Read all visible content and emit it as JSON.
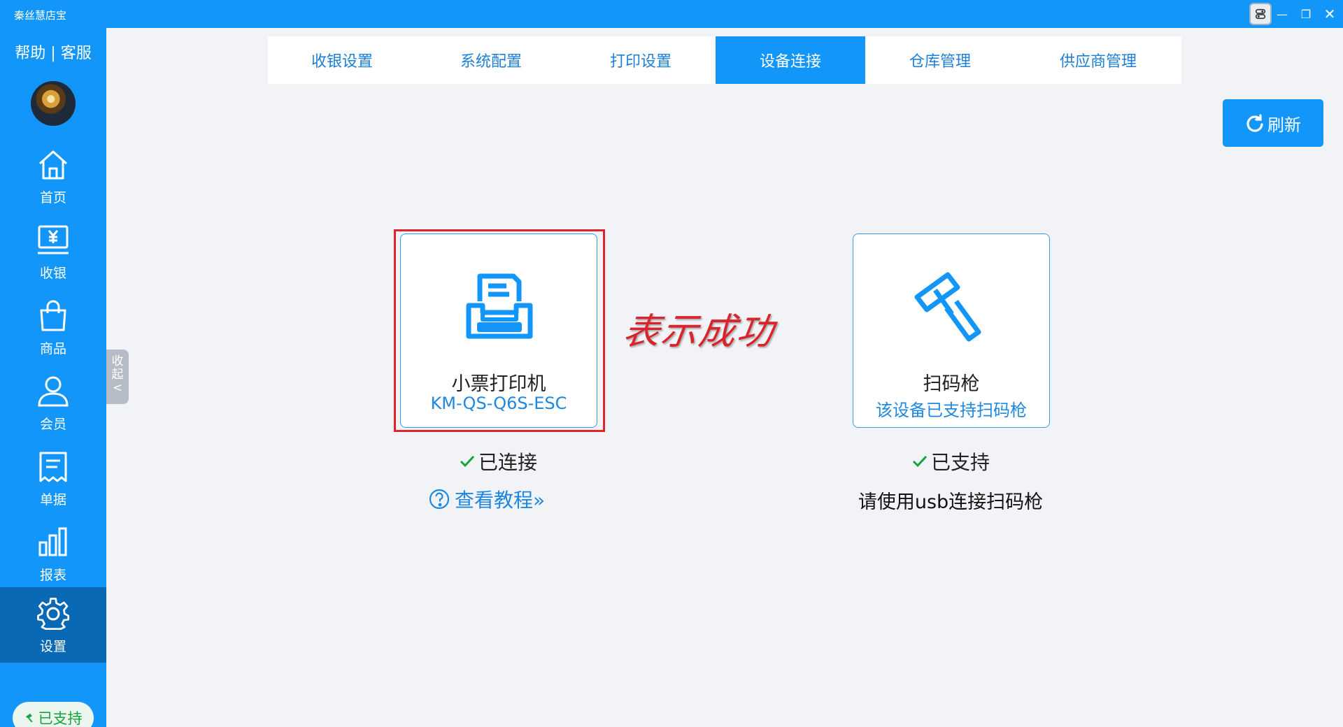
{
  "window": {
    "title": "秦丝慧店宝",
    "controls": {
      "minimize": "—",
      "maximize": "❐",
      "close": "✕"
    }
  },
  "sidebar": {
    "help": "帮助 | 客服",
    "collapse": "收\n起\n<",
    "items": [
      {
        "label": "首页",
        "icon": "home-icon"
      },
      {
        "label": "收银",
        "icon": "cashier-icon"
      },
      {
        "label": "商品",
        "icon": "shopping-bag-icon"
      },
      {
        "label": "会员",
        "icon": "member-icon"
      },
      {
        "label": "单据",
        "icon": "receipt-icon"
      },
      {
        "label": "报表",
        "icon": "bar-chart-icon"
      },
      {
        "label": "设置",
        "icon": "gear-icon",
        "active": true
      }
    ],
    "support_badge": "已支持"
  },
  "tabs": [
    {
      "label": "收银设置"
    },
    {
      "label": "系统配置"
    },
    {
      "label": "打印设置"
    },
    {
      "label": "设备连接",
      "active": true
    },
    {
      "label": "仓库管理"
    },
    {
      "label": "供应商管理"
    }
  ],
  "toolbar": {
    "refresh_label": "刷新"
  },
  "devices": {
    "printer": {
      "name": "小票打印机",
      "model": "KM-QS-Q6S-ESC",
      "status": "已连接",
      "tutorial_link": "查看教程»"
    },
    "scanner": {
      "name": "扫码枪",
      "subtitle": "该设备已支持扫码枪",
      "status": "已支持",
      "note": "请使用usb连接扫码枪"
    }
  },
  "annotation": {
    "text": "表示成功"
  },
  "colors": {
    "primary": "#1296fa",
    "sidebar_active": "#0a69b5",
    "link": "#1e88e0",
    "success": "#18a23a",
    "annotation_red": "#e0242b",
    "background": "#f2f3f6"
  }
}
